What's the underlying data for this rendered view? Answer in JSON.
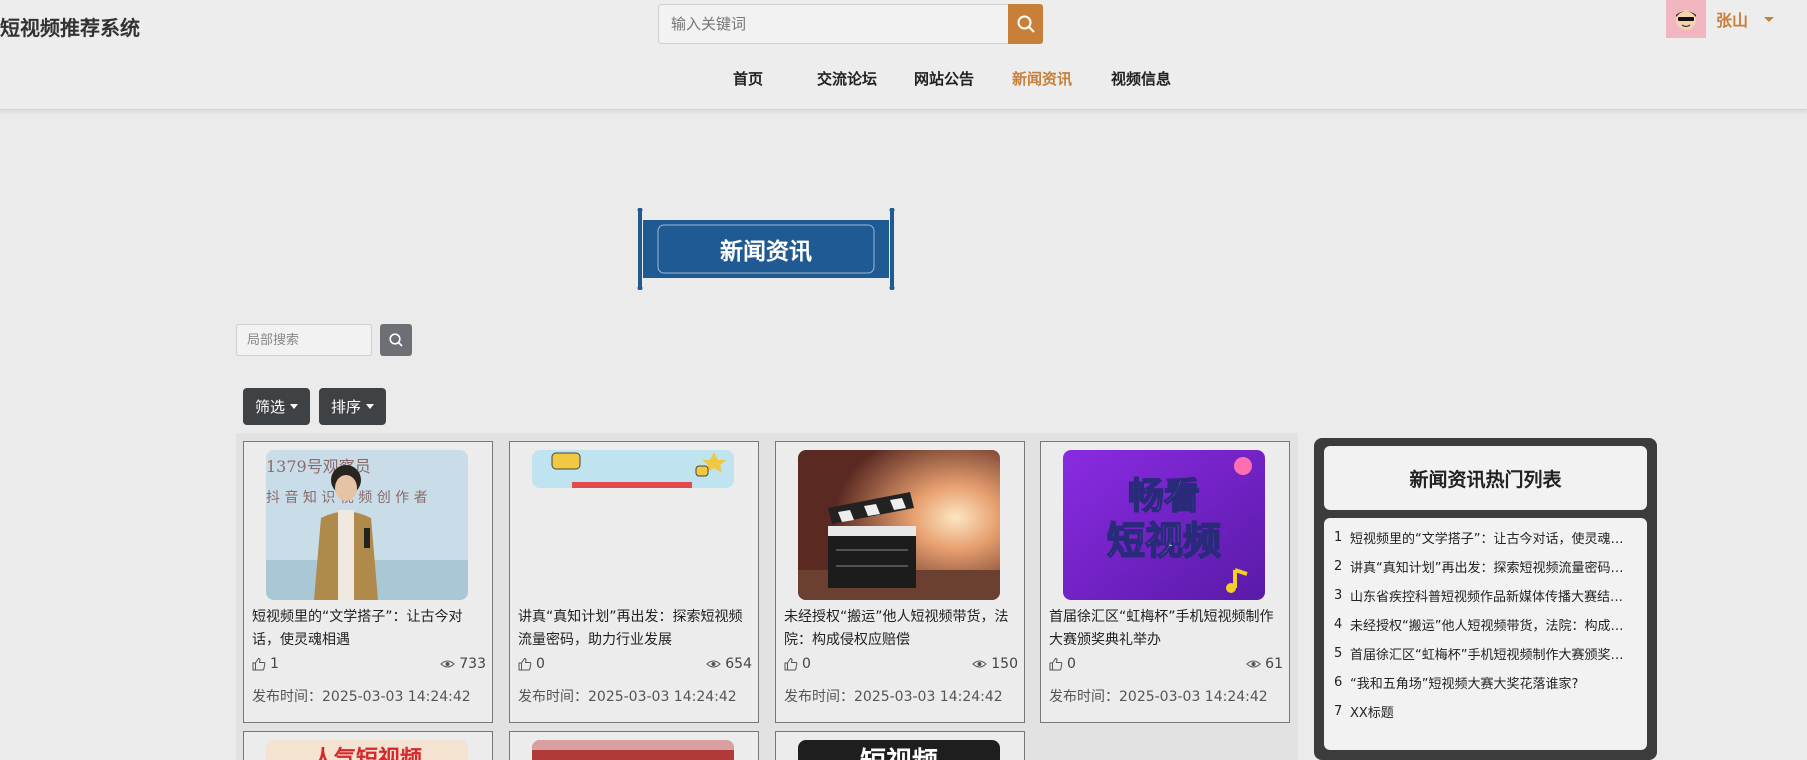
{
  "header": {
    "brand": "短视频推荐系统",
    "search_placeholder": "输入关键词",
    "user_name": "张山"
  },
  "nav": [
    {
      "label": "首页",
      "active": false
    },
    {
      "label": "交流论坛",
      "active": false
    },
    {
      "label": "网站公告",
      "active": false
    },
    {
      "label": "新闻资讯",
      "active": true
    },
    {
      "label": "视频信息",
      "active": false
    }
  ],
  "banner": {
    "title": "新闻资讯"
  },
  "local_search": {
    "placeholder": "局部搜索"
  },
  "filters": {
    "filter_label": "筛选",
    "sort_label": "排序"
  },
  "colors": {
    "accent": "#c87f3a",
    "banner_blue": "#1f5a92",
    "dark": "#3f4245"
  },
  "cards": [
    {
      "title": "短视频里的“文学搭子”：让古今对话，使灵魂相遇",
      "likes": "1",
      "views": "733",
      "time": "发布时间：2025-03-03 14:24:42",
      "image_text": "1379号观察员 抖音知识视频创作者",
      "image_text_1": "1379号观察员",
      "image_text_2": "抖 音 知 识 视 频 创 作 者"
    },
    {
      "title": "讲真“真知计划”再出发：探索短视频流量密码，助力行业发展",
      "likes": "0",
      "views": "654",
      "time": "发布时间：2025-03-03 14:24:42"
    },
    {
      "title": "未经授权“搬运”他人短视频带货，法院：构成侵权应赔偿",
      "likes": "0",
      "views": "150",
      "time": "发布时间：2025-03-03 14:24:42"
    },
    {
      "title": "首届徐汇区“虹梅杯”手机短视频制作大赛颁奖典礼举办",
      "likes": "0",
      "views": "61",
      "time": "发布时间：2025-03-03 14:24:42",
      "image_text_1": "畅看",
      "image_text_2": "短视频"
    }
  ],
  "partial_cards": [
    {
      "image_text": "人气短视频"
    },
    {
      "image_text": ""
    },
    {
      "image_text": "短视频"
    }
  ],
  "hot_list": {
    "title": "新闻资讯热门列表",
    "items": [
      {
        "num": "1",
        "text": "短视频里的“文学搭子”：让古今对话，使灵魂相遇"
      },
      {
        "num": "2",
        "text": "讲真“真知计划”再出发：探索短视频流量密码，助力行业发展"
      },
      {
        "num": "3",
        "text": "山东省疾控科普短视频作品新媒体传播大赛结果公布"
      },
      {
        "num": "4",
        "text": "未经授权“搬运”他人短视频带货，法院：构成侵权应赔偿"
      },
      {
        "num": "5",
        "text": "首届徐汇区“虹梅杯”手机短视频制作大赛颁奖典礼举办"
      },
      {
        "num": "6",
        "text": "“我和五角场”短视频大赛大奖花落谁家?"
      },
      {
        "num": "7",
        "text": "XX标题"
      }
    ]
  }
}
